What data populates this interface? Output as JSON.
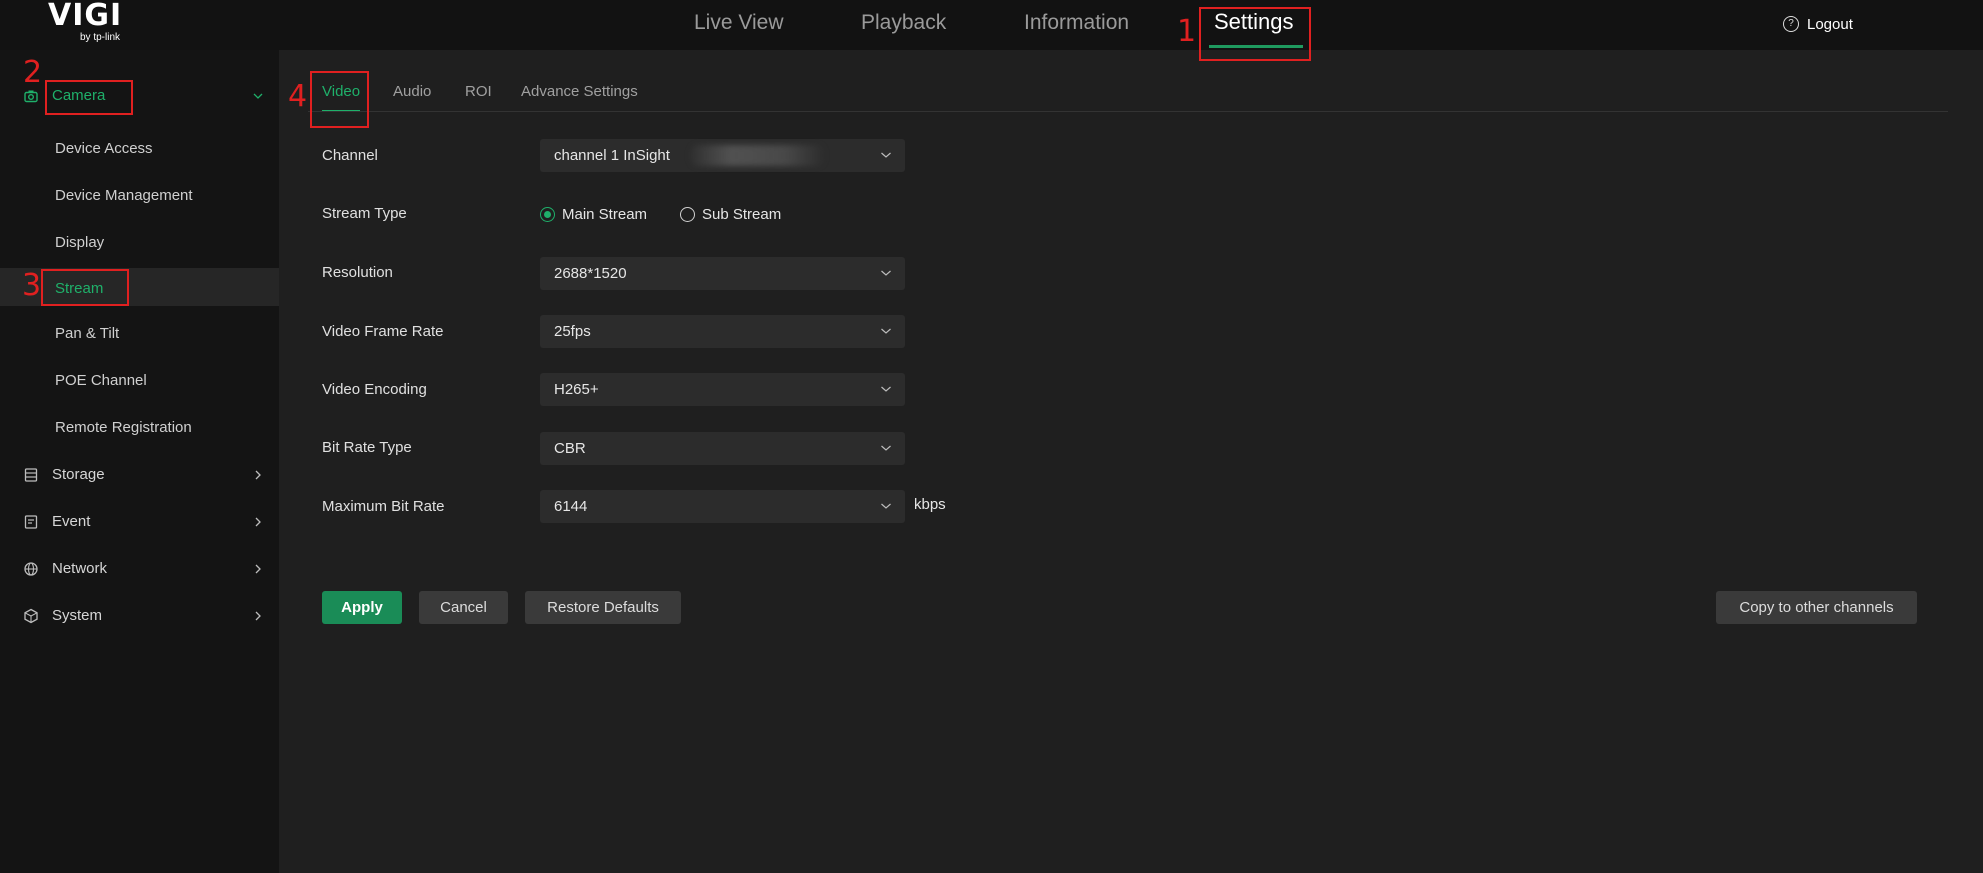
{
  "brand": {
    "name": "VIGI",
    "tagline": "by tp-link"
  },
  "top_nav": {
    "items": [
      "Live View",
      "Playback",
      "Information",
      "Settings"
    ],
    "active": "Settings",
    "logout_label": "Logout"
  },
  "sidebar": {
    "camera": {
      "label": "Camera",
      "items": [
        "Device Access",
        "Device Management",
        "Display",
        "Stream",
        "Pan & Tilt",
        "POE Channel",
        "Remote Registration"
      ],
      "selected": "Stream"
    },
    "groups": [
      "Storage",
      "Event",
      "Network",
      "System"
    ]
  },
  "tabs": {
    "items": [
      "Video",
      "Audio",
      "ROI",
      "Advance Settings"
    ],
    "active": "Video"
  },
  "form": {
    "channel": {
      "label": "Channel",
      "value": "channel 1 InSight"
    },
    "stream_type": {
      "label": "Stream Type",
      "options": [
        "Main Stream",
        "Sub Stream"
      ],
      "selected": "Main Stream"
    },
    "resolution": {
      "label": "Resolution",
      "value": "2688*1520"
    },
    "frame_rate": {
      "label": "Video Frame Rate",
      "value": "25fps"
    },
    "encoding": {
      "label": "Video Encoding",
      "value": "H265+"
    },
    "bit_rate_type": {
      "label": "Bit Rate Type",
      "value": "CBR"
    },
    "max_bit_rate": {
      "label": "Maximum Bit Rate",
      "value": "6144",
      "unit": "kbps"
    }
  },
  "buttons": {
    "apply": "Apply",
    "cancel": "Cancel",
    "restore": "Restore Defaults",
    "copy": "Copy to other channels"
  },
  "annotations": [
    "1",
    "2",
    "3",
    "4"
  ],
  "colors": {
    "accent": "#1fb06a",
    "annotation": "#e02020",
    "background": "#1f1f1f",
    "sidebar": "#141414"
  }
}
